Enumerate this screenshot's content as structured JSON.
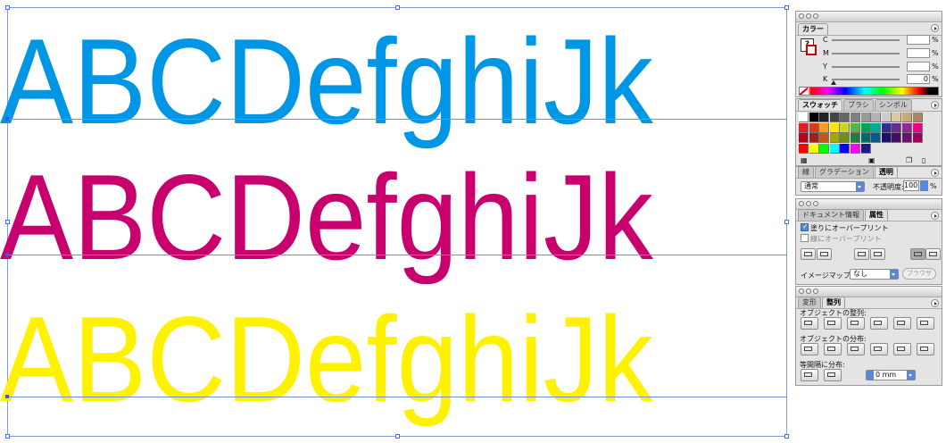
{
  "canvas": {
    "lines": [
      {
        "text": "ABCDefghiJk",
        "color": "#0096e6"
      },
      {
        "text": "ABCDefghiJk",
        "color": "#c8006e"
      },
      {
        "text": "ABCDefghiJk",
        "color": "#fff200"
      }
    ]
  },
  "color_panel": {
    "tab": "カラー",
    "channels": [
      {
        "label": "C",
        "value": "",
        "unit": "%"
      },
      {
        "label": "M",
        "value": "",
        "unit": "%"
      },
      {
        "label": "Y",
        "value": "",
        "unit": "%"
      },
      {
        "label": "K",
        "value": "0",
        "unit": "%"
      }
    ]
  },
  "swatch_panel": {
    "tabs": [
      "スウォッチ",
      "ブラシ",
      "シンボル"
    ],
    "swatch_colors": [
      "#ffffff",
      "#000000",
      "#222222",
      "#444444",
      "#666666",
      "#808080",
      "#999999",
      "#b3b3b3",
      "#cccccc",
      "#e0c9a0",
      "#c8a878",
      "#a88860",
      "#e6191e",
      "#d93a1a",
      "#f2a11f",
      "#ffe600",
      "#c8d81c",
      "#4db848",
      "#00a651",
      "#00a99d",
      "#2e3192",
      "#662d91",
      "#92278f",
      "#ec008c",
      "#b8001a",
      "#9e1f1f",
      "#c2571a",
      "#a6a600",
      "#6f8f1a",
      "#1e7d3a",
      "#006b66",
      "#0a5a8a",
      "#1b1464",
      "#440e62",
      "#63166a",
      "#9e005d",
      "#ff0000",
      "#ffff00",
      "#00ff00",
      "#00ffff",
      "#0000ff",
      "#ff00ff",
      "#1a1a80"
    ]
  },
  "transparency_panel": {
    "tabs": [
      "線",
      "グラデーション",
      "透明"
    ],
    "blend_mode": "通常",
    "opacity_label": "不透明度:",
    "opacity_value": "100",
    "opacity_unit": "%"
  },
  "attributes_panel": {
    "tabs": [
      "ドキュメント情報",
      "属性"
    ],
    "overprint_fill": "塗りにオーバープリント",
    "overprint_stroke": "線にオーバープリント",
    "image_map_label": "イメージマップ:",
    "image_map_value": "なし",
    "browser_button": "ブラウザ"
  },
  "align_panel": {
    "tabs": [
      "変形",
      "整列"
    ],
    "align_objects_label": "オブジェクトの整列:",
    "distribute_objects_label": "オブジェクトの分布:",
    "distribute_spacing_label": "等間隔に分布:",
    "spacing_value": "0 mm"
  }
}
